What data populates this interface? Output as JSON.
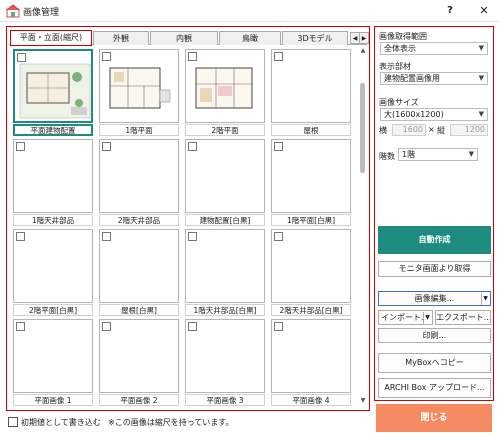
{
  "window": {
    "title": "画像管理",
    "help_label": "?",
    "close_label": "✕",
    "accent": "#1f8a7f",
    "highlight": "#d10000"
  },
  "tabs": [
    {
      "label": "平面・立面(縮尺)",
      "active": true
    },
    {
      "label": "外観",
      "active": false
    },
    {
      "label": "内観",
      "active": false
    },
    {
      "label": "鳥瞰",
      "active": false
    },
    {
      "label": "3Dモデル",
      "active": false
    }
  ],
  "tab_nav": {
    "prev": "◀",
    "next": "▶"
  },
  "thumbnails": [
    {
      "caption": "平面建物配置",
      "selected": true,
      "image": "site-plan"
    },
    {
      "caption": "1階平面",
      "selected": false,
      "image": "floor-plan-1"
    },
    {
      "caption": "2階平面",
      "selected": false,
      "image": "floor-plan-2"
    },
    {
      "caption": "屋根",
      "selected": false,
      "image": ""
    },
    {
      "caption": "1階天井部品",
      "selected": false,
      "image": ""
    },
    {
      "caption": "2階天井部品",
      "selected": false,
      "image": ""
    },
    {
      "caption": "建物配置[白黒]",
      "selected": false,
      "image": ""
    },
    {
      "caption": "1階平面[白黒]",
      "selected": false,
      "image": ""
    },
    {
      "caption": "2階平面[白黒]",
      "selected": false,
      "image": ""
    },
    {
      "caption": "屋根[白黒]",
      "selected": false,
      "image": ""
    },
    {
      "caption": "1階天井部品[白黒]",
      "selected": false,
      "image": ""
    },
    {
      "caption": "2階天井部品[白黒]",
      "selected": false,
      "image": ""
    },
    {
      "caption": "平面画像 1",
      "selected": false,
      "image": ""
    },
    {
      "caption": "平面画像 2",
      "selected": false,
      "image": ""
    },
    {
      "caption": "平面画像 3",
      "selected": false,
      "image": ""
    },
    {
      "caption": "平面画像 4",
      "selected": false,
      "image": ""
    }
  ],
  "bottom": {
    "checkbox_label": "初期値として書き込む",
    "note": "※この画像は縮尺を持っています。"
  },
  "panel": {
    "range_label": "画像取得範囲",
    "range_value": "全体表示",
    "parts_label": "表示部材",
    "parts_value": "建物配置画像用",
    "size_label": "画像サイズ",
    "size_value": "大(1600x1200)",
    "width_label": "横",
    "width_value": "1600",
    "times_label": "×",
    "height_label": "縦",
    "height_value": "1200",
    "floor_label": "階数",
    "floor_value": "1階",
    "auto_create": "自動作成",
    "from_monitor": "モニタ画面より取得",
    "edit_image": "画像編集...",
    "import": "インポート...",
    "export": "エクスポート...",
    "print": "印刷...",
    "copy_mybox": "MyBoxへコピー",
    "upload_archibox": "ARCHI Box アップロード...",
    "close": "閉じる"
  }
}
